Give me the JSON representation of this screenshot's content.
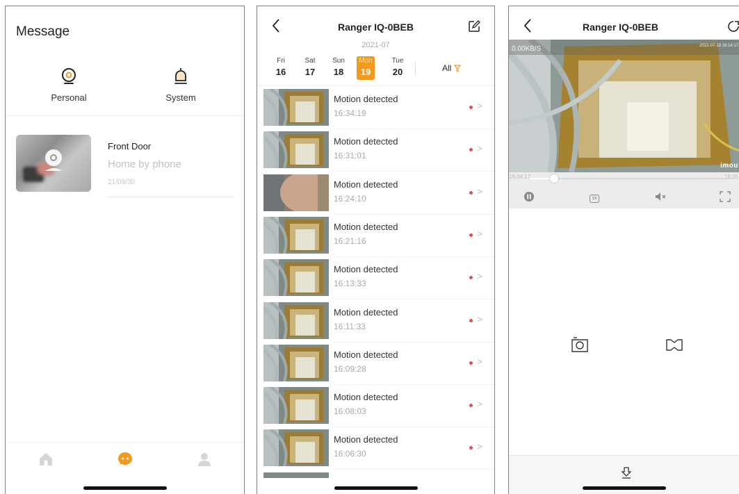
{
  "panel1": {
    "title": "Message",
    "categories": [
      {
        "label": "Personal",
        "icon": "personal-icon"
      },
      {
        "label": "System",
        "icon": "bell-icon"
      }
    ],
    "message": {
      "device": "Front Door",
      "text": "Home by phone",
      "date": "21/09/30"
    },
    "tabs": [
      {
        "icon": "home-icon"
      },
      {
        "icon": "message-icon",
        "active_color": "#f29a20"
      },
      {
        "icon": "user-icon"
      }
    ]
  },
  "panel2": {
    "title": "Ranger IQ-0BEB",
    "year_month": "2021-07",
    "days": [
      {
        "name": "Fri",
        "num": "16"
      },
      {
        "name": "Sat",
        "num": "17"
      },
      {
        "name": "Sun",
        "num": "18"
      },
      {
        "name": "Mon",
        "num": "19",
        "active": true
      },
      {
        "name": "Tue",
        "num": "20"
      }
    ],
    "filter_label": "All",
    "accent": "#f29a20",
    "events": [
      {
        "title": "Motion detected",
        "time": "16:34:19"
      },
      {
        "title": "Motion detected",
        "time": "16:31:01"
      },
      {
        "title": "Motion detected",
        "time": "16:24:10"
      },
      {
        "title": "Motion detected",
        "time": "16:21:16"
      },
      {
        "title": "Motion detected",
        "time": "16:13:33"
      },
      {
        "title": "Motion detected",
        "time": "16:11:33"
      },
      {
        "title": "Motion detected",
        "time": "16:09:28"
      },
      {
        "title": "Motion detected",
        "time": "16:08:03"
      },
      {
        "title": "Motion detected",
        "time": "16:06:30"
      }
    ]
  },
  "panel3": {
    "title": "Ranger IQ-0BEB",
    "osd_rate": "0.00KB/S",
    "osd_timestamp": "2021-07-19 16:14:17",
    "brand_logo": "imou",
    "time_start": "16:34:17",
    "time_end": "16:35",
    "speed_label": "1X",
    "progress": 0.12
  }
}
